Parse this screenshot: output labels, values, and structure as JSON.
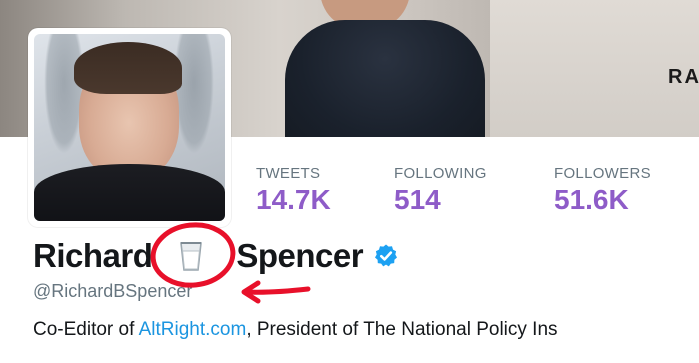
{
  "banner": {
    "text": "RA"
  },
  "stats": [
    {
      "label": "TWEETS",
      "value": "14.7K"
    },
    {
      "label": "FOLLOWING",
      "value": "514"
    },
    {
      "label": "FOLLOWERS",
      "value": "51.6K"
    }
  ],
  "profile": {
    "name_first": "Richard",
    "name_last": "Spencer",
    "name_emoji_icon": "glass-of-milk-icon",
    "verified_icon": "verified-badge-icon",
    "handle": "@RichardBSpencer",
    "bio_prefix": "Co-Editor of ",
    "bio_link": "AltRight.com",
    "bio_suffix": ", President of The National Policy Ins"
  },
  "colors": {
    "accent_purple": "#8e5cc8",
    "link_blue": "#1b95e0",
    "verified_blue": "#1da1f2",
    "annotation_red": "#e8102a"
  }
}
